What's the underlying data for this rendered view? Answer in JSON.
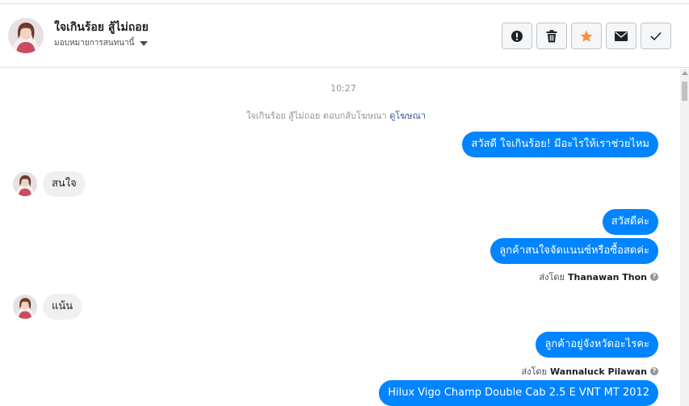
{
  "header": {
    "contact_name": "ใจเกินร้อย สู้ไม่ถอย",
    "assign_label": "มอบหมายการสนทนานี้",
    "actions": [
      {
        "name": "mark-spam-button",
        "icon": "alert-circle-icon"
      },
      {
        "name": "delete-button",
        "icon": "trash-icon"
      },
      {
        "name": "star-button",
        "icon": "star-icon",
        "color": "#f7923b"
      },
      {
        "name": "mark-unread-button",
        "icon": "envelope-icon"
      },
      {
        "name": "mark-done-button",
        "icon": "check-icon"
      }
    ]
  },
  "thread": {
    "timestamp": "10:27",
    "reply_note": "ใจเกินร้อย สู้ไม่ถอย ตอบกลับโฆษณา",
    "reply_link": "ดูโฆษณา",
    "messages": [
      {
        "direction": "out",
        "text": "สวัสดี ใจเกินร้อย! มีอะไรให้เราช่วยไหม"
      },
      {
        "direction": "in",
        "text": "สนใจ"
      },
      {
        "direction": "out",
        "text": "สวัสดีค่ะ"
      },
      {
        "direction": "out",
        "text": "ลูกค้าสนใจจัดแนนซ์หรือซื้อสดค่ะ"
      },
      {
        "direction": "in",
        "text": "แน้น"
      },
      {
        "direction": "out",
        "text": "ลูกค้าอยู่จังหวัดอะไรคะ"
      },
      {
        "direction": "out",
        "text": "Hilux Vigo Champ Double Cab 2.5 E VNT MT 2012"
      }
    ],
    "sent_by": [
      {
        "prefix": "ส่งโดย",
        "agent": "Thanawan Thon"
      },
      {
        "prefix": "ส่งโดย",
        "agent": "Wannaluck Pilawan"
      }
    ]
  },
  "colors": {
    "outgoing_bubble": "#0084ff",
    "incoming_bubble": "#f1f0f0",
    "link": "#385898",
    "star": "#f7923b"
  }
}
